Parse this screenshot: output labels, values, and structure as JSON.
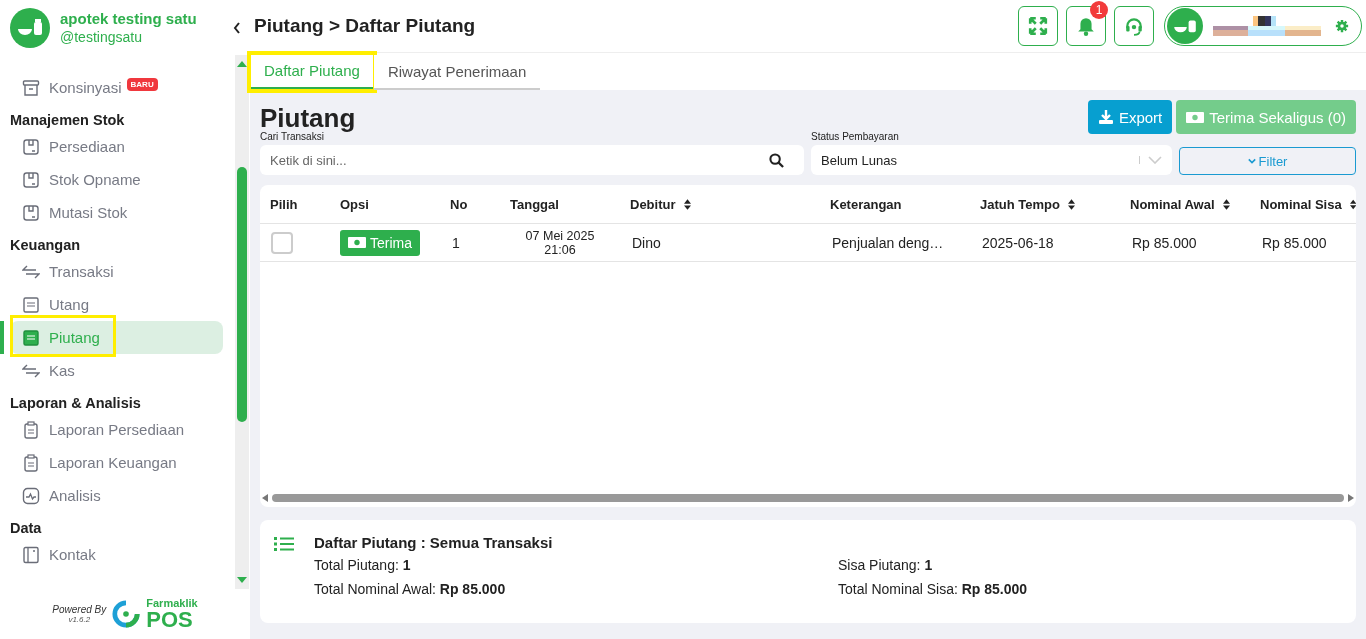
{
  "brand": {
    "name": "apotek testing satu",
    "handle": "@testingsatu"
  },
  "sidebar": {
    "groups": [
      {
        "items": [
          {
            "label": "Konsinyasi",
            "kind": "box",
            "badge": "BARU",
            "selected": false,
            "highlighted": false
          }
        ]
      },
      {
        "title": "Manajemen Stok",
        "items": [
          {
            "label": "Persediaan",
            "kind": "package",
            "selected": false,
            "highlighted": false
          },
          {
            "label": "Stok Opname",
            "kind": "package",
            "selected": false,
            "highlighted": false
          },
          {
            "label": "Mutasi Stok",
            "kind": "package",
            "selected": false,
            "highlighted": false
          }
        ]
      },
      {
        "title": "Keuangan",
        "items": [
          {
            "label": "Transaksi",
            "kind": "transfer",
            "selected": false,
            "highlighted": false
          },
          {
            "label": "Utang",
            "kind": "receipt",
            "selected": false,
            "highlighted": false
          },
          {
            "label": "Piutang",
            "kind": "receipt",
            "selected": true,
            "highlighted": true
          },
          {
            "label": "Kas",
            "kind": "transfer",
            "selected": false,
            "highlighted": false
          }
        ]
      },
      {
        "title": "Laporan & Analisis",
        "items": [
          {
            "label": "Laporan Persediaan",
            "kind": "clipboard",
            "selected": false,
            "highlighted": false
          },
          {
            "label": "Laporan Keuangan",
            "kind": "clipboard",
            "selected": false,
            "highlighted": false
          },
          {
            "label": "Analisis",
            "kind": "chart",
            "selected": false,
            "highlighted": false
          }
        ]
      },
      {
        "title": "Data",
        "items": [
          {
            "label": "Kontak",
            "kind": "contact",
            "selected": false,
            "highlighted": false
          }
        ]
      }
    ]
  },
  "footer": {
    "powered": "Powered By",
    "version": "v1.6.2",
    "logo_top": "Farmaklik",
    "logo_bottom": "POS"
  },
  "header": {
    "breadcrumb": "Piutang > Daftar Piutang",
    "notification_count": "1"
  },
  "tabs": [
    {
      "label": "Daftar Piutang",
      "selected": true,
      "highlighted": true
    },
    {
      "label": "Riwayat Penerimaan",
      "selected": false,
      "highlighted": false
    }
  ],
  "page": {
    "title": "Piutang",
    "export": "Export",
    "bulk_receive": {
      "label": "Terima Sekaligus (0)",
      "disabled": true
    },
    "search": {
      "label": "Cari Transaksi",
      "placeholder": "Ketik di sini..."
    },
    "status": {
      "label": "Status Pembayaran",
      "value": "Belum Lunas"
    },
    "filter": "Filter"
  },
  "table": {
    "columns": [
      {
        "label": "Pilih",
        "sortable": false
      },
      {
        "label": "Opsi",
        "sortable": false
      },
      {
        "label": "No",
        "sortable": false
      },
      {
        "label": "Tanggal",
        "sortable": false
      },
      {
        "label": "Debitur",
        "sortable": true
      },
      {
        "label": "Keterangan",
        "sortable": false
      },
      {
        "label": "Jatuh Tempo",
        "sortable": true
      },
      {
        "label": "Nominal Awal",
        "sortable": true
      },
      {
        "label": "Nominal Sisa",
        "sortable": true
      }
    ],
    "rows": [
      {
        "checked": false,
        "action": "Terima",
        "no": "1",
        "date": "07 Mei 2025",
        "time": "21:06",
        "debtor": "Dino",
        "note": "Penjualan deng…",
        "due": "2025-06-18",
        "initial": "Rp 85.000",
        "remaining": "Rp 85.000"
      }
    ]
  },
  "summary": {
    "title": "Daftar Piutang : Semua Transaksi",
    "stats": [
      {
        "label": "Total Piutang:",
        "value": "1"
      },
      {
        "label": "Sisa Piutang:",
        "value": "1"
      },
      {
        "label": "Total Nominal Awal:",
        "value": "Rp 85.000"
      },
      {
        "label": "Total Nominal Sisa:",
        "value": "Rp 85.000"
      }
    ]
  }
}
